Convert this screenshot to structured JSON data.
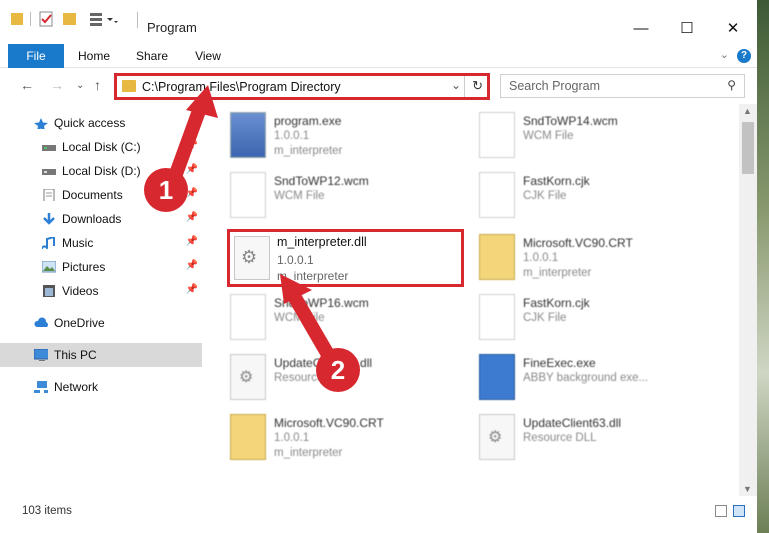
{
  "window": {
    "title": "Program"
  },
  "ribbon": {
    "tabs": [
      "File",
      "Home",
      "Share",
      "View"
    ],
    "help": "?"
  },
  "nav": {
    "address": "C:\\Program Files\\Program Directory",
    "search_placeholder": "Search Program"
  },
  "sidebar": {
    "items": [
      {
        "label": "Quick access",
        "icon": "star-icon"
      },
      {
        "label": "Local Disk (C:)",
        "icon": "drive-icon",
        "pinned": true
      },
      {
        "label": "Local Disk (D:)",
        "icon": "drive-icon",
        "pinned": true
      },
      {
        "label": "Documents",
        "icon": "documents-icon",
        "pinned": true
      },
      {
        "label": "Downloads",
        "icon": "download-icon",
        "pinned": true
      },
      {
        "label": "Music",
        "icon": "music-icon",
        "pinned": true
      },
      {
        "label": "Pictures",
        "icon": "pictures-icon",
        "pinned": true
      },
      {
        "label": "Videos",
        "icon": "videos-icon",
        "pinned": true
      },
      {
        "label": "OneDrive",
        "icon": "cloud-icon"
      },
      {
        "label": "This PC",
        "icon": "computer-icon",
        "selected": true
      },
      {
        "label": "Network",
        "icon": "network-icon"
      }
    ]
  },
  "files": [
    {
      "name": "program.exe",
      "l2": "1.0.0.1",
      "l3": "m_interpreter",
      "kind": "exe"
    },
    {
      "name": "SndToWP14.wcm",
      "l2": "WCM File",
      "l3": "",
      "kind": "doc"
    },
    {
      "name": "SndToWP12.wcm",
      "l2": "WCM File",
      "l3": "",
      "kind": "doc"
    },
    {
      "name": "FastKorn.cjk",
      "l2": "CJK File",
      "l3": "",
      "kind": "doc"
    },
    {
      "name": "Microsoft.VC90.CRT",
      "l2": "1.0.0.1",
      "l3": "m_interpreter",
      "kind": "vc"
    },
    {
      "name": "SndToWP16.wcm",
      "l2": "WCM File",
      "l3": "",
      "kind": "doc"
    },
    {
      "name": "FastKorn.cjk",
      "l2": "CJK File",
      "l3": "",
      "kind": "doc"
    },
    {
      "name": "UpdateClient61.dll",
      "l2": "Resource DLL",
      "l3": "",
      "kind": "dll"
    },
    {
      "name": "FineExec.exe",
      "l2": "ABBY background exe...",
      "l3": "",
      "kind": "abby"
    },
    {
      "name": "Microsoft.VC90.CRT",
      "l2": "1.0.0.1",
      "l3": "m_interpreter",
      "kind": "vc"
    },
    {
      "name": "UpdateClient63.dll",
      "l2": "Resource DLL",
      "l3": "",
      "kind": "dll"
    }
  ],
  "highlighted_file": {
    "name": "m_interpreter.dll",
    "l2": "1.0.0.1",
    "l3": "m_interpreter"
  },
  "status": {
    "count": "103 items"
  },
  "annotations": {
    "step1": "1",
    "step2": "2",
    "color": "#d8282f"
  }
}
